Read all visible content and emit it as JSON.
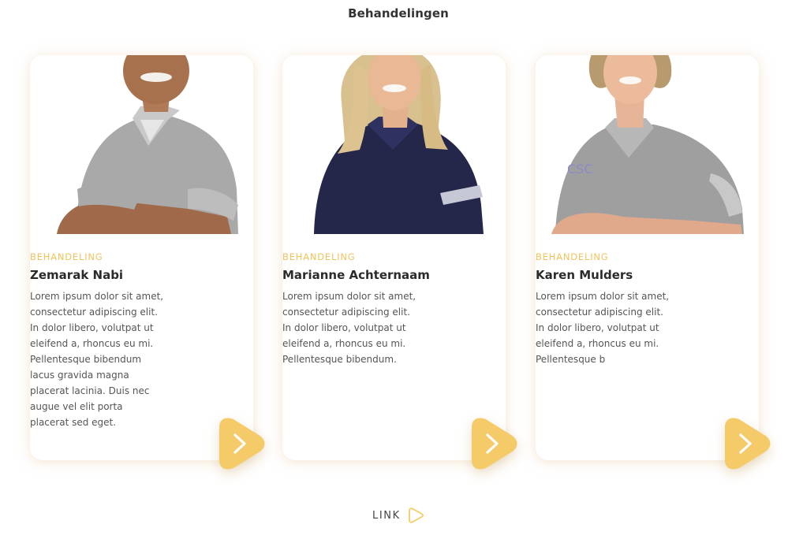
{
  "section": {
    "title": "Behandelingen"
  },
  "cards": [
    {
      "eyebrow": "BEHANDELING",
      "name": "Zemarak Nabi",
      "description": "Lorem ipsum dolor sit amet, consectetur adipiscing elit. In dolor libero, volutpat ut eleifend a, rhoncus eu mi. Pellentesque bibendum lacus gravida magna placerat lacinia. Duis nec augue vel elit porta placerat sed eget.",
      "shirt_color": "#a8a8a8"
    },
    {
      "eyebrow": "BEHANDELING",
      "name": "Marianne Achternaam",
      "description": "Lorem ipsum dolor sit amet, consectetur adipiscing elit. In dolor libero, volutpat ut eleifend a, rhoncus eu mi. Pellentesque bibendum.",
      "shirt_color": "#24264a"
    },
    {
      "eyebrow": "BEHANDELING",
      "name": "Karen Mulders",
      "description": "Lorem ipsum dolor sit amet, consectetur adipiscing elit. In dolor libero, volutpat ut eleifend a, rhoncus eu mi. Pellentesque b",
      "shirt_color": "#9d9d9d"
    }
  ],
  "footer_link": {
    "label": "LINK",
    "icon": "play-outline-icon"
  },
  "colors": {
    "accent": "#f5cb6a",
    "eyebrow": "#f0c35c",
    "text": "#333333"
  }
}
